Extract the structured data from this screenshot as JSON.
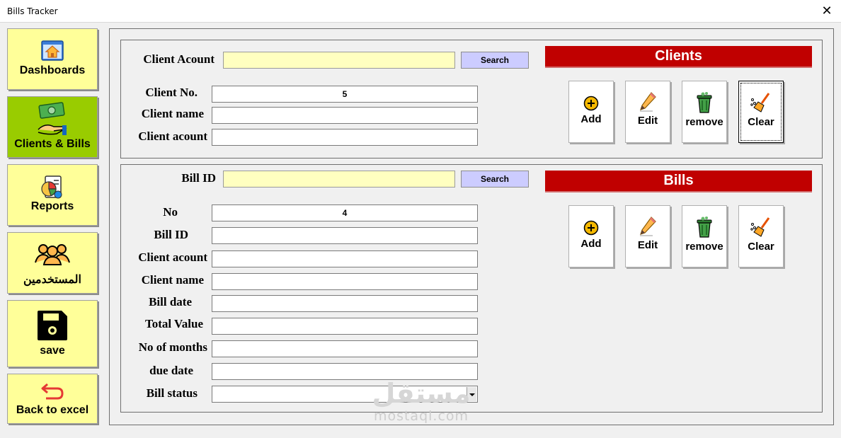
{
  "window": {
    "title": "Bills Tracker",
    "close_glyph": "✕"
  },
  "nav": [
    {
      "label": "Dashboards",
      "icon": "dashboard-home-icon"
    },
    {
      "label": "Clients & Bills",
      "icon": "money-hand-icon",
      "active": true
    },
    {
      "label": "Reports",
      "icon": "report-chart-icon"
    },
    {
      "label": "المستخدمين",
      "icon": "users-icon"
    },
    {
      "label": "save",
      "icon": "floppy-disk-icon"
    },
    {
      "label": "Back to excel",
      "icon": "back-arrow-icon"
    }
  ],
  "clients": {
    "header": "Clients",
    "account_label": "Client Acount",
    "account_value": "",
    "search_label": "Search",
    "fields": [
      {
        "label": "Client No.",
        "value": "5"
      },
      {
        "label": "Client name",
        "value": ""
      },
      {
        "label": "Client acount",
        "value": ""
      }
    ],
    "buttons": {
      "add": "Add",
      "edit": "Edit",
      "remove": "remove",
      "clear": "Clear"
    }
  },
  "bills": {
    "header": "Bills",
    "id_label": "Bill ID",
    "id_value": "",
    "search_label": "Search",
    "fields": [
      {
        "label": "No",
        "value": "4"
      },
      {
        "label": "Bill ID",
        "value": ""
      },
      {
        "label": "Client acount",
        "value": ""
      },
      {
        "label": "Client name",
        "value": ""
      },
      {
        "label": "Bill date",
        "value": ""
      },
      {
        "label": "Total Value",
        "value": ""
      },
      {
        "label": "No of months",
        "value": ""
      },
      {
        "label": "due date",
        "value": ""
      },
      {
        "label": "Bill status",
        "value": ""
      }
    ],
    "buttons": {
      "add": "Add",
      "edit": "Edit",
      "remove": "remove",
      "clear": "Clear"
    }
  },
  "watermark": {
    "arabic": "مستقل",
    "latin": "mostaql.com"
  }
}
